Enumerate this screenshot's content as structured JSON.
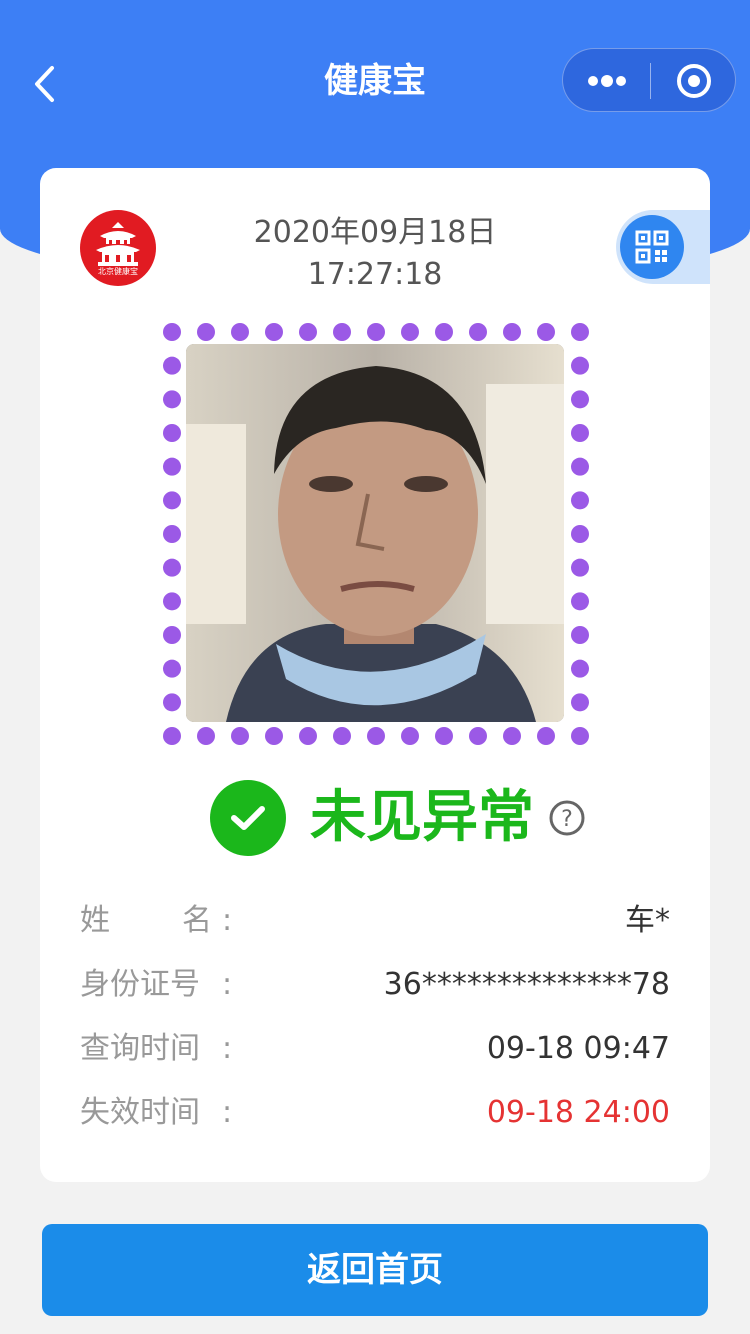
{
  "nav": {
    "title": "健康宝"
  },
  "card": {
    "logo_text": "北京健康宝",
    "date": "2020年09月18日",
    "time": "17:27:18"
  },
  "status": {
    "text": "未见异常",
    "color": "#1bb71b"
  },
  "info": [
    {
      "label": "姓名",
      "value": "车*"
    },
    {
      "label": "身份证号",
      "value": "36**************78"
    },
    {
      "label": "查询时间",
      "value": "09-18 09:47"
    },
    {
      "label": "失效时间",
      "value": "09-18 24:00",
      "value_color": "#e53333"
    }
  ],
  "home_button": {
    "label": "返回首页"
  },
  "colors": {
    "header_blue": "#3d7ff5",
    "button_blue": "#1b8ce9",
    "frame_purple": "#9b59e6",
    "logo_red": "#e11b22"
  }
}
